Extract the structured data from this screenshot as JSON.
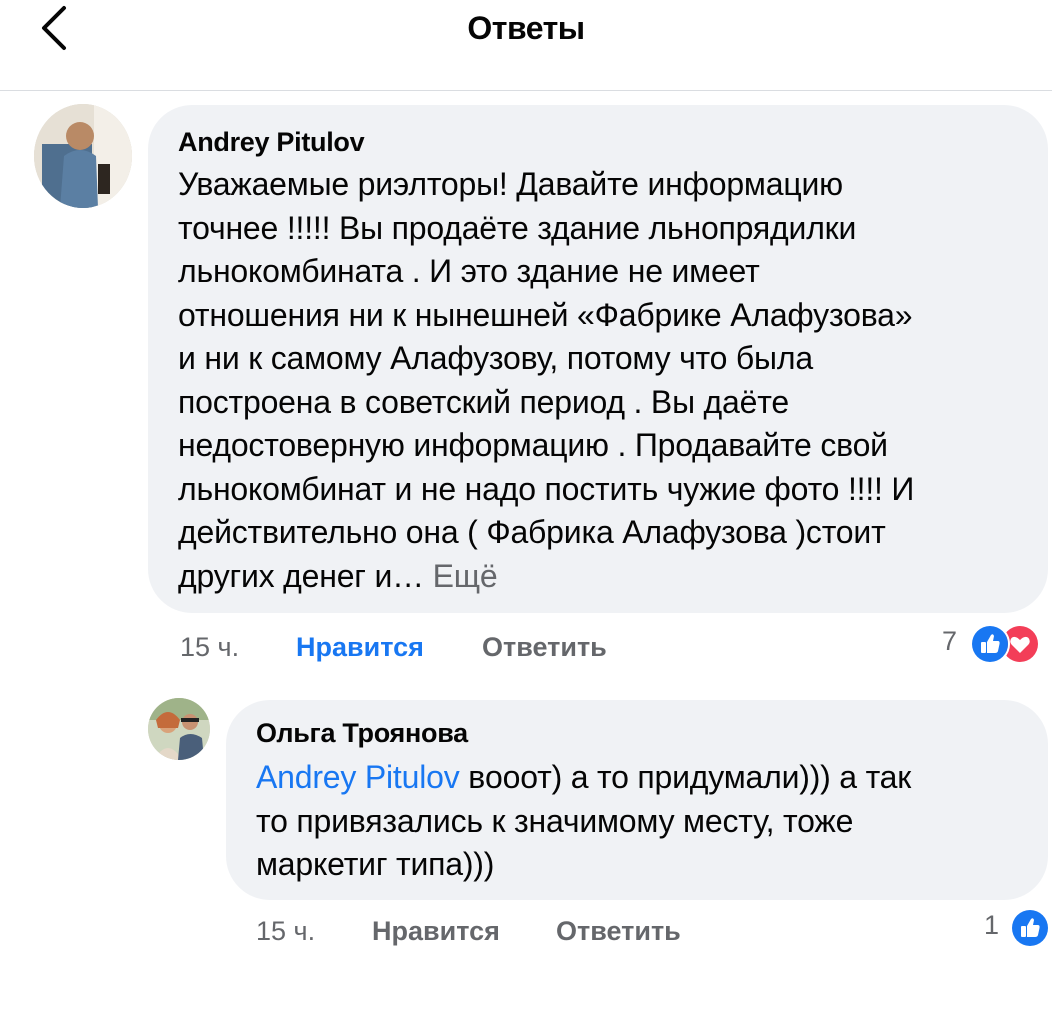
{
  "header": {
    "title": "Ответы",
    "back_icon": "chevron-left-icon"
  },
  "comments": [
    {
      "author": "Andrey Pitulov",
      "text_lines": [
        "Уважаемые риэлторы! Давайте информацию",
        "точнее !!!!! Вы продаёте здание льнопрядилки",
        "льнокомбината . И это здание не имеет",
        "отношения ни к нынешней «Фабрике Алафузова»",
        "и ни к самому Алафузову, потому что была",
        "построена в советский период . Вы даёте",
        "недостоверную информацию . Продавайте свой",
        "льнокомбинат и не надо постить  чужие фото !!!! И",
        "действительно она ( Фабрика Алафузова  )стоит",
        "других денег и… "
      ],
      "more_label": "Ещё",
      "time": "15 ч.",
      "like_label": "Нравится",
      "reply_label": "Ответить",
      "reaction_count": "7",
      "reactions": [
        "like-icon",
        "love-icon"
      ],
      "colors": {
        "like_active": "#1877f2"
      }
    },
    {
      "author": "Ольга Троянова",
      "mention": "Andrey Pitulov",
      "text_first": " вooот) а то придумали))) а так",
      "text_lines": [
        "то привязались к значимому месту, тоже",
        "маркетиг типа)))"
      ],
      "time": "15 ч.",
      "like_label": "Нравится",
      "reply_label": "Ответить",
      "reaction_count": "1",
      "reactions": [
        "like-icon"
      ]
    }
  ],
  "colors": {
    "bubble_bg": "#f0f2f5",
    "secondary_text": "#65676b",
    "accent_blue": "#1877f2",
    "love_red": "#f33e58"
  }
}
